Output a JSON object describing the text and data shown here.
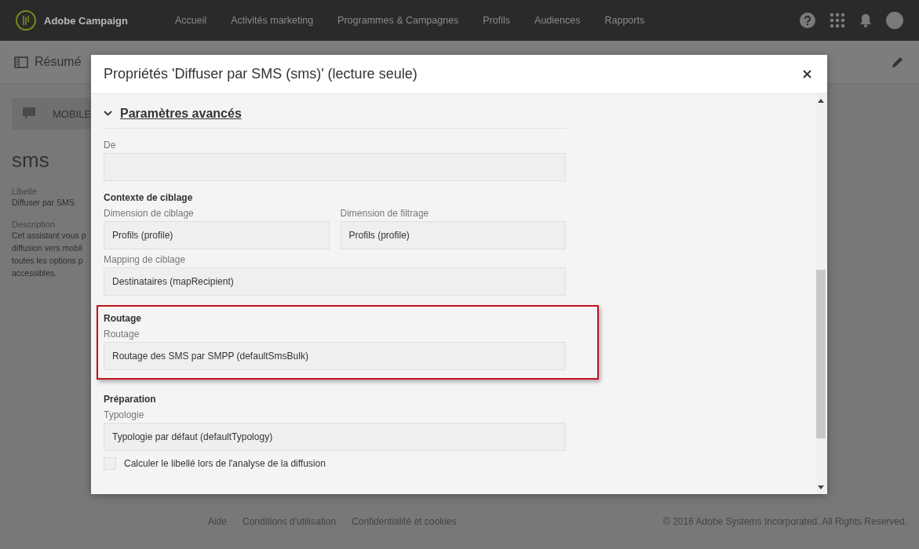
{
  "app": {
    "name": "Adobe Campaign"
  },
  "nav": {
    "items": [
      "Accueil",
      "Activités marketing",
      "Programmes & Campagnes",
      "Profils",
      "Audiences",
      "Rapports"
    ]
  },
  "page": {
    "title": "Résumé",
    "card_label": "MOBILE",
    "name": "sms",
    "label_title": "Libellé",
    "label_value": "Diffuser par SMS",
    "description_title": "Description",
    "description_lines": [
      "Cet assistant vous p",
      "diffusion vers mobil",
      "toutes les options p",
      "accessibles."
    ]
  },
  "footer": {
    "links": [
      "Aide",
      "Conditions d'utilisation",
      "Confidentialité et cookies"
    ],
    "copyright": "© 2016 Adobe Systems Incorporated. All Rights Reserved."
  },
  "dialog": {
    "title": "Propriétés 'Diffuser par SMS (sms)' (lecture seule)",
    "section": {
      "title": "Paramètres avancés",
      "expanded": true
    },
    "groups": [
      {
        "highlighted": false,
        "rows": [
          [
            {
              "label": "De"
            }
          ]
        ]
      },
      {
        "heading": "Contexte de ciblage",
        "highlighted": false,
        "rows": [
          [
            {
              "label": "Dimension de ciblage",
              "value": "Profils (profile)"
            },
            {
              "label": "Dimension de filtrage",
              "value": "Profils (profile)"
            }
          ],
          [
            {
              "label": "Mapping de ciblage",
              "value": "Destinataires (mapRecipient)"
            }
          ]
        ]
      },
      {
        "heading": "Routage",
        "highlighted": true,
        "rows": [
          [
            {
              "label": "Routage",
              "value": "Routage des SMS par SMPP (defaultSmsBulk)"
            }
          ]
        ]
      },
      {
        "heading": "Préparation",
        "highlighted": false,
        "rows": [
          [
            {
              "label": "Typologie",
              "value": "Typologie par défaut (defaultTypology)"
            }
          ]
        ],
        "checkboxes": [
          {
            "label": "Calculer le libellé lors de l'analyse de la diffusion",
            "checked": false
          }
        ]
      }
    ]
  }
}
